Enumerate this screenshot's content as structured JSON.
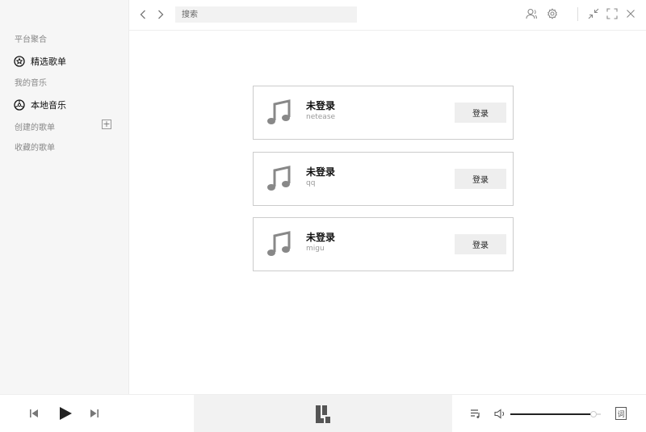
{
  "sidebar": {
    "section_platform": "平台聚合",
    "item_featured": "精选歌单",
    "section_my_music": "我的音乐",
    "item_local": "本地音乐",
    "section_created": "创建的歌单",
    "add_symbol": "+",
    "section_collected": "收藏的歌单"
  },
  "header": {
    "search_placeholder": "搜索"
  },
  "accounts": [
    {
      "status": "未登录",
      "platform": "netease",
      "button": "登录"
    },
    {
      "status": "未登录",
      "platform": "qq",
      "button": "登录"
    },
    {
      "status": "未登录",
      "platform": "migu",
      "button": "登录"
    }
  ],
  "player": {
    "volume": 0.92,
    "lyric_label": "词"
  },
  "colors": {
    "sidebar_bg": "#f6f6f6",
    "card_border": "#cccccc",
    "button_bg": "#eeeeee",
    "icon_gray": "#888888"
  }
}
